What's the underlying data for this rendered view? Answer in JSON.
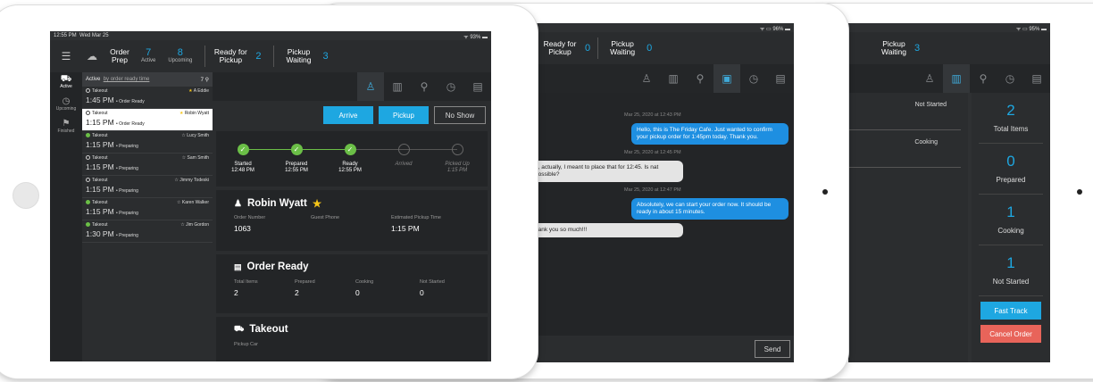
{
  "screen1": {
    "status": {
      "time": "12:55 PM",
      "date": "Wed Mar 25",
      "battery": "93%"
    },
    "topbar": {
      "order_prep": {
        "label": "Order Prep",
        "active_num": "7",
        "active_label": "Active",
        "upcoming_num": "8",
        "upcoming_label": "Upcoming"
      },
      "ready": {
        "label": "Ready for Pickup",
        "num": "2"
      },
      "waiting": {
        "label": "Pickup Waiting",
        "num": "3"
      }
    },
    "nav": [
      {
        "label": "Active",
        "icon": "car-icon"
      },
      {
        "label": "Upcoming",
        "icon": "clock-icon"
      },
      {
        "label": "Finished",
        "icon": "finished-icon"
      }
    ],
    "list_header": {
      "label": "Active",
      "sort": "by order ready time",
      "count": "7"
    },
    "orders": [
      {
        "type": "Takeout",
        "name": "A Eddie",
        "time": "1:45 PM",
        "status": "Order Ready",
        "dot": "open",
        "star": true
      },
      {
        "type": "Takeout",
        "name": "Robin Wyatt",
        "time": "1:15 PM",
        "status": "Order Ready",
        "dot": "open",
        "star": true,
        "selected": true
      },
      {
        "type": "Takeout",
        "name": "Lucy Smith",
        "time": "1:15 PM",
        "status": "Preparing",
        "dot": "green"
      },
      {
        "type": "Takeout",
        "name": "Sam Smith",
        "time": "1:15 PM",
        "status": "Preparing",
        "dot": "open"
      },
      {
        "type": "Takeout",
        "name": "Jimmy Todeski",
        "time": "1:15 PM",
        "status": "Preparing",
        "dot": "open"
      },
      {
        "type": "Takeout",
        "name": "Karen Walker",
        "time": "1:15 PM",
        "status": "Preparing",
        "dot": "green"
      },
      {
        "type": "Takeout",
        "name": "Jim Gordon",
        "time": "1:30 PM",
        "status": "Preparing",
        "dot": "green"
      }
    ],
    "buttons": {
      "arrive": "Arrive",
      "pickup": "Pickup",
      "noshow": "No Show"
    },
    "steps": [
      {
        "label": "Started",
        "time": "12:48 PM"
      },
      {
        "label": "Prepared",
        "time": "12:55 PM"
      },
      {
        "label": "Ready",
        "time": "12:55 PM"
      },
      {
        "label": "Arrived",
        "time": ""
      },
      {
        "label": "Picked Up",
        "time": "1:15 PM"
      }
    ],
    "customer": {
      "name": "Robin Wyatt",
      "order_number_label": "Order Number",
      "order_number": "1063",
      "phone_label": "Guest Phone",
      "eta_label": "Estimated Pickup Time",
      "eta": "1:15 PM"
    },
    "order_ready": {
      "title": "Order Ready",
      "total_label": "Total Items",
      "total": "2",
      "prepared_label": "Prepared",
      "prepared": "2",
      "cooking_label": "Cooking",
      "cooking": "0",
      "notstarted_label": "Not Started",
      "notstarted": "0"
    },
    "takeout": {
      "title": "Takeout",
      "car_label": "Pickup Car"
    }
  },
  "screen2": {
    "status": {
      "battery": "96%"
    },
    "topbar": {
      "ready": {
        "label": "Ready for Pickup",
        "num": "0"
      },
      "waiting": {
        "label": "Pickup Waiting",
        "num": "0"
      }
    },
    "messages": {
      "ts1": "Mar 25, 2020 at 12:43 PM",
      "m1": "Hello, this is The Friday Cafe. Just wanted to confirm your pickup order for 1:45pm today. Thank you.",
      "ts2": "Mar 25, 2020 at 12:45 PM",
      "m2": "h, actually, I meant to place that for 12:45. Is nat possible?",
      "ts3": "Mar 25, 2020 at 12:47 PM",
      "m3": "Absolutely, we can start your order now. It should be ready in about 15 minutes.",
      "m4": "hank you so much!!!"
    },
    "send": "Send"
  },
  "screen3": {
    "status": {
      "battery": "95%"
    },
    "topbar": {
      "waiting": {
        "label": "Pickup Waiting",
        "num": "3"
      }
    },
    "items": [
      {
        "status": "Not Started"
      },
      {
        "status": "Cooking"
      }
    ],
    "counts": [
      {
        "num": "2",
        "label": "Total Items"
      },
      {
        "num": "0",
        "label": "Prepared"
      },
      {
        "num": "1",
        "label": "Cooking"
      },
      {
        "num": "1",
        "label": "Not Started"
      }
    ],
    "fast_track": "Fast Track",
    "cancel": "Cancel Order",
    "colors": {
      "fast_track": "#1ea7e1",
      "cancel": "#e8645a"
    }
  }
}
